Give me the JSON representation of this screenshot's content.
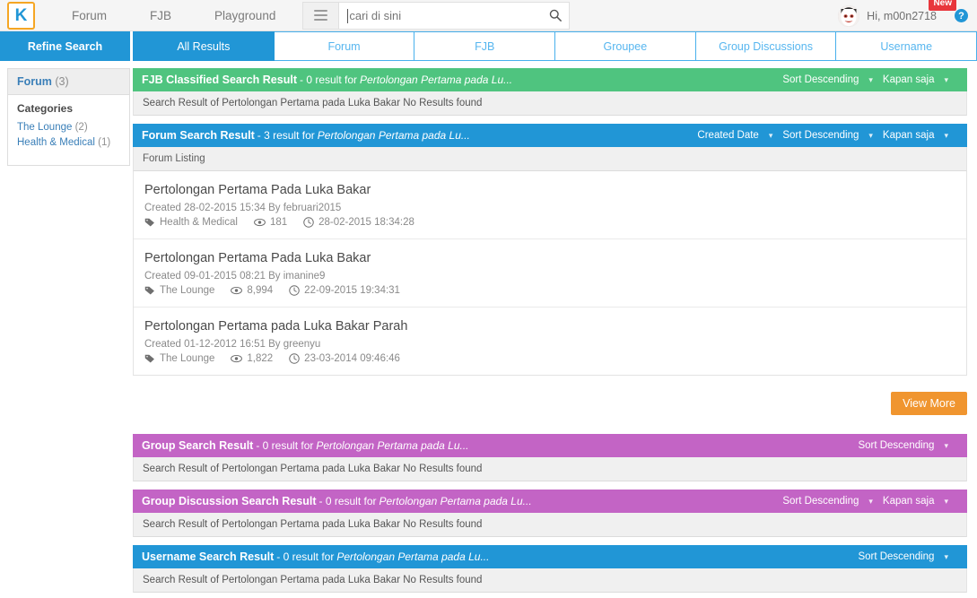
{
  "topnav": {
    "logo_letter": "K",
    "links": [
      {
        "label": "Forum"
      },
      {
        "label": "FJB"
      },
      {
        "label": "Playground"
      }
    ],
    "search": {
      "placeholder": "cari di sini",
      "value": "",
      "menu_icon": "hamburger-icon",
      "search_icon": "search-icon"
    },
    "user": {
      "greeting": "Hi, m00n2718",
      "badge": "New",
      "help": "?"
    }
  },
  "tabs": {
    "refine_label": "Refine Search",
    "items": [
      {
        "label": "All Results",
        "active": true
      },
      {
        "label": "Forum",
        "active": false
      },
      {
        "label": "FJB",
        "active": false
      },
      {
        "label": "Groupee",
        "active": false
      },
      {
        "label": "Group Discussions",
        "active": false
      },
      {
        "label": "Username",
        "active": false
      }
    ]
  },
  "sidebar": {
    "header": "Forum",
    "header_count": "(3)",
    "categories_title": "Categories",
    "categories": [
      {
        "label": "The Lounge",
        "count": "(2)"
      },
      {
        "label": "Health & Medical",
        "count": "(1)"
      }
    ]
  },
  "blocks": {
    "fjb": {
      "title": "FJB Classified Search Result",
      "sub": "- 0 result for",
      "query": "Pertolongan Pertama pada Lu...",
      "options": [
        {
          "label": "Sort Descending"
        },
        {
          "label": "Kapan saja"
        }
      ],
      "empty_text": "Search Result of Pertolongan Pertama pada Luka Bakar No Results found"
    },
    "forum": {
      "title": "Forum Search Result",
      "sub": "- 3 result for",
      "query": "Pertolongan Pertama pada Lu...",
      "options": [
        {
          "label": "Created Date"
        },
        {
          "label": "Sort Descending"
        },
        {
          "label": "Kapan saja"
        }
      ],
      "listing_label": "Forum Listing",
      "items": [
        {
          "title": "Pertolongan Pertama Pada Luka Bakar",
          "created": "Created 28-02-2015 15:34 By februari2015",
          "category": "Health & Medical",
          "views": "181",
          "last_post": "28-02-2015 18:34:28"
        },
        {
          "title": "Pertolongan Pertama Pada Luka Bakar",
          "created": "Created 09-01-2015 08:21 By imanine9",
          "category": "The Lounge",
          "views": "8,994",
          "last_post": "22-09-2015 19:34:31"
        },
        {
          "title": "Pertolongan Pertama pada Luka Bakar Parah",
          "created": "Created 01-12-2012 16:51 By greenyu",
          "category": "The Lounge",
          "views": "1,822",
          "last_post": "23-03-2014 09:46:46"
        }
      ],
      "view_more": "View More"
    },
    "group": {
      "title": "Group Search Result",
      "sub": "- 0 result for",
      "query": "Pertolongan Pertama pada Lu...",
      "options": [
        {
          "label": "Sort Descending"
        }
      ],
      "empty_text": "Search Result of Pertolongan Pertama pada Luka Bakar No Results found"
    },
    "group_discussion": {
      "title": "Group Discussion Search Result",
      "sub": "- 0 result for",
      "query": "Pertolongan Pertama pada Lu...",
      "options": [
        {
          "label": "Sort Descending"
        },
        {
          "label": "Kapan saja"
        }
      ],
      "empty_text": "Search Result of Pertolongan Pertama pada Luka Bakar No Results found"
    },
    "username": {
      "title": "Username Search Result",
      "sub": "- 0 result for",
      "query": "Pertolongan Pertama pada Lu...",
      "options": [
        {
          "label": "Sort Descending"
        }
      ],
      "empty_text": "Search Result of Pertolongan Pertama pada Luka Bakar No Results found"
    }
  },
  "colors": {
    "brand_blue": "#2196d6",
    "tab_border": "#48b0ec",
    "green": "#4fc47f",
    "purple": "#c364c5",
    "orange": "#f0952f",
    "logo_orange": "#f5a623",
    "badge_red": "#e8363c"
  }
}
